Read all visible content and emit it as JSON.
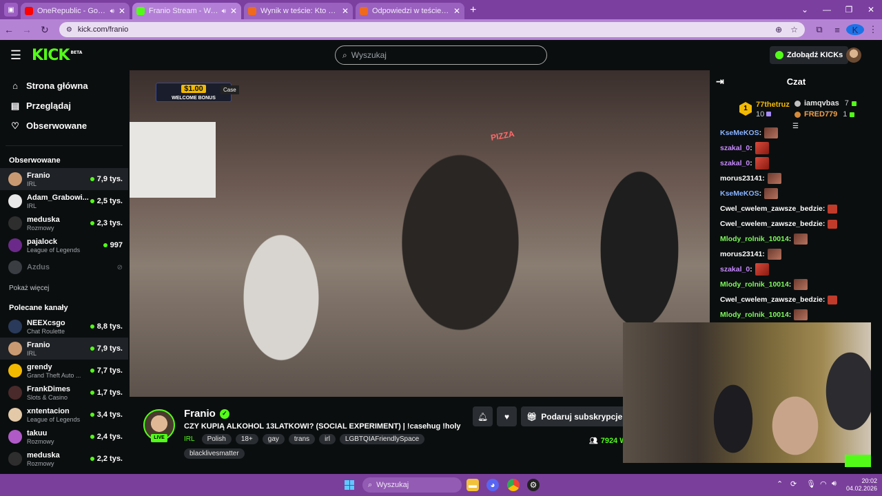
{
  "browser": {
    "tabs": [
      {
        "title": "OneRepublic - Good Life (Official...",
        "favicon_color": "#ff0000",
        "audio": true
      },
      {
        "title": "Franio Stream - Watch Live on Kick",
        "favicon_color": "#53fc18",
        "audio": true,
        "active": true
      },
      {
        "title": "Wynik w teście: Kto pierwszy...",
        "favicon_color": "#f06a1d"
      },
      {
        "title": "Odpowiedzi w teście: Kto pierw...",
        "favicon_color": "#f06a1d"
      }
    ],
    "url": "kick.com/franio",
    "profile_initial": "K"
  },
  "kick": {
    "logo": "KICK",
    "logo_sup": "BETA",
    "search_placeholder": "Wyszukaj",
    "get_kicks": "Zdobądź KICKs"
  },
  "sidebar": {
    "nav": [
      {
        "label": "Strona główna",
        "icon": "home-icon"
      },
      {
        "label": "Przeglądaj",
        "icon": "browse-icon"
      },
      {
        "label": "Obserwowane",
        "icon": "heart-icon"
      }
    ],
    "followed_header": "Obserwowane",
    "followed": [
      {
        "name": "Franio",
        "category": "IRL",
        "viewers": "7,9 tys.",
        "color": "#c99a72"
      },
      {
        "name": "Adam_Grabowi...",
        "category": "IRL",
        "viewers": "2,5 tys.",
        "color": "#e8e8e8"
      },
      {
        "name": "meduska",
        "category": "Rozmowy",
        "viewers": "2,3 tys.",
        "color": "#2e2e2e"
      },
      {
        "name": "pajalock",
        "category": "League of Legends",
        "viewers": "997",
        "color": "#6b2a8a"
      }
    ],
    "offline": {
      "name": "Azdus"
    },
    "show_more": "Pokaż więcej",
    "recommended_header": "Polecane kanały",
    "recommended": [
      {
        "name": "NEEXcsgo",
        "category": "Chat Roulette",
        "viewers": "8,8 tys.",
        "color": "#2a3a5a"
      },
      {
        "name": "Franio",
        "category": "IRL",
        "viewers": "7,9 tys.",
        "color": "#c99a72"
      },
      {
        "name": "grendy",
        "category": "Grand Theft Auto ...",
        "viewers": "7,7 tys.",
        "color": "#f2b900"
      },
      {
        "name": "FrankDimes",
        "category": "Slots & Casino",
        "viewers": "1,7 tys.",
        "color": "#4a2a2a"
      },
      {
        "name": "xntentacion",
        "category": "League of Legends",
        "viewers": "3,4 tys.",
        "color": "#e3c9a8"
      },
      {
        "name": "takuu",
        "category": "Rozmowy",
        "viewers": "2,4 tys.",
        "color": "#b05ac8"
      },
      {
        "name": "meduska",
        "category": "Rozmowy",
        "viewers": "2,2 tys.",
        "color": "#2e2e2e"
      }
    ]
  },
  "video": {
    "bonus_amount": "$1.00",
    "bonus_text": "WELCOME BONUS",
    "sponsor": "Case",
    "sign": "PIZZA"
  },
  "stream": {
    "streamer": "Franio",
    "live_badge": "LIVE",
    "title": "CZY KUPIĄ ALKOHOL 13LATKOWI? (SOCIAL EXPERIMENT) | !casehug !holy",
    "category": "IRL",
    "tags": [
      "Polish",
      "18+",
      "gay",
      "trans",
      "irl",
      "LGBTQIAFriendlySpace",
      "blacklivesmatter"
    ],
    "subscribe_button": "Podaruj subskrypcje",
    "viewers": "7924 W"
  },
  "chat": {
    "title": "Czat",
    "top_gifter": {
      "rank": "1",
      "name": "77thetruz",
      "count": "10"
    },
    "gifters": [
      {
        "name": "iamqvbas",
        "count": "7"
      },
      {
        "name": "FRED779",
        "count": "1"
      }
    ],
    "messages": [
      {
        "user": "KseMeKOS",
        "color": "#8ab4ff",
        "emote": "face"
      },
      {
        "user": "szakal_0",
        "color": "#c78bff",
        "emote": "red"
      },
      {
        "user": "szakal_0",
        "color": "#c78bff",
        "emote": "red"
      },
      {
        "user": "morus23141",
        "color": "#ffffff",
        "emote": "face"
      },
      {
        "user": "KseMeKOS",
        "color": "#8ab4ff",
        "emote": "face"
      },
      {
        "user": "Cwel_cwelem_zawsze_bedzie",
        "color": "#ffffff",
        "emote": "small"
      },
      {
        "user": "Cwel_cwelem_zawsze_bedzie",
        "color": "#ffffff",
        "emote": "small"
      },
      {
        "user": "Mlody_rolnik_10014",
        "color": "#7cfc5a",
        "emote": "face"
      },
      {
        "user": "morus23141",
        "color": "#ffffff",
        "emote": "face"
      },
      {
        "user": "szakal_0",
        "color": "#c78bff",
        "emote": "red"
      },
      {
        "user": "Mlody_rolnik_10014",
        "color": "#7cfc5a",
        "emote": "face"
      },
      {
        "user": "Cwel_cwelem_zawsze_bedzie",
        "color": "#ffffff",
        "emote": "small"
      },
      {
        "user": "Mlody_rolnik_10014",
        "color": "#7cfc5a",
        "emote": "face"
      }
    ]
  },
  "taskbar": {
    "search_placeholder": "Wyszukaj",
    "time": "20:02",
    "date": "04.02.2026"
  }
}
